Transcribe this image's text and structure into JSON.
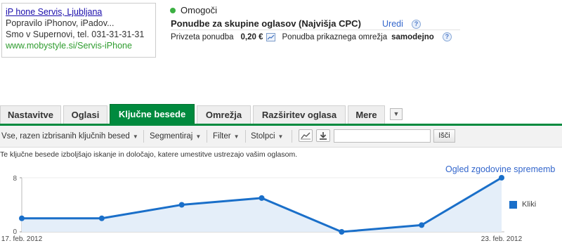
{
  "ad_preview": {
    "headline": "iP hone Servis, Ljubljana",
    "line1": "Popravilo iPhonov, iPadov...",
    "line2": "Smo v Supernovi, tel. 031-31-31-31",
    "display_url": "www.mobystyle.si/Servis-iPhone"
  },
  "status": {
    "label": "Omogoči",
    "color": "#3cb043"
  },
  "bids": {
    "title": "Ponudbe za skupine oglasov (Najvišja CPC)",
    "edit_label": "Uredi",
    "default_bid_label": "Privzeta ponudba",
    "default_bid_value": "0,20 €",
    "display_network_label": "Ponudba prikaznega omrežja",
    "display_network_value": "samodejno"
  },
  "tabs": [
    {
      "label": "Nastavitve",
      "active": false
    },
    {
      "label": "Oglasi",
      "active": false
    },
    {
      "label": "Ključne besede",
      "active": true
    },
    {
      "label": "Omrežja",
      "active": false
    },
    {
      "label": "Razširitev oglasa",
      "active": false
    },
    {
      "label": "Mere",
      "active": false
    }
  ],
  "accent_color": "#008a3e",
  "toolbar": {
    "filter_select": "Vse, razen izbrisanih ključnih besed",
    "segment": "Segmentiraj",
    "filter": "Filter",
    "columns": "Stolpci",
    "search_placeholder": "",
    "search_button": "Išči"
  },
  "info_text": "Te ključne besede izboljšajo iskanje in določajo, katere umestitve ustrezajo vašim oglasom.",
  "history_link": "Ogled zgodovine sprememb",
  "chart_data": {
    "type": "area",
    "x": [
      "17. feb. 2012",
      "18. feb. 2012",
      "19. feb. 2012",
      "20. feb. 2012",
      "21. feb. 2012",
      "22. feb. 2012",
      "23. feb. 2012"
    ],
    "series": [
      {
        "name": "Kliki",
        "values": [
          2,
          2,
          4,
          5,
          0,
          1,
          8
        ],
        "color": "#1a6fc9"
      }
    ],
    "y_ticks": [
      "8",
      "0"
    ],
    "x_tick_labels": [
      "17. feb. 2012",
      "23. feb. 2012"
    ],
    "ylim": [
      0,
      8
    ],
    "legend_position": "right"
  }
}
